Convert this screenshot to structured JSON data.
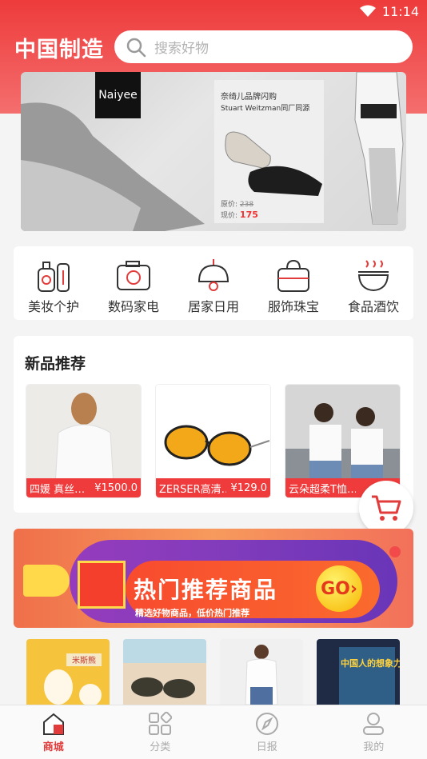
{
  "status": {
    "time": "11:14"
  },
  "header": {
    "brand": "中国制造",
    "search_placeholder": "搜索好物"
  },
  "banner": {
    "logo": "Naiyee",
    "card_line1": "奈绮儿品牌闪购",
    "card_line2": "Stuart Weitzman同厂同源",
    "orig_label": "原价:",
    "orig_price": "238",
    "now_label": "现价:",
    "now_price": "175"
  },
  "categories": [
    {
      "label": "美妆个护",
      "icon": "cosmetics-icon"
    },
    {
      "label": "数码家电",
      "icon": "camera-icon"
    },
    {
      "label": "居家日用",
      "icon": "lamp-icon"
    },
    {
      "label": "服饰珠宝",
      "icon": "bag-icon"
    },
    {
      "label": "食品酒饮",
      "icon": "bowl-icon"
    }
  ],
  "new_section": {
    "title": "新品推荐",
    "products": [
      {
        "name": "四媛 真丝…",
        "price": "¥1500.0"
      },
      {
        "name": "ZERSER高清…",
        "price": "¥129.0"
      },
      {
        "name": "云朵超柔T恤…",
        "price": "¥"
      }
    ]
  },
  "promo": {
    "title": "热门推荐商品",
    "subtitle": "精选好物商品，低价热门推荐",
    "go": "GO›"
  },
  "thumb_texts": {
    "t1": "米斯熊",
    "t4": "中国人的想象力"
  },
  "tabs": [
    {
      "label": "商城",
      "icon": "home-icon"
    },
    {
      "label": "分类",
      "icon": "category-icon"
    },
    {
      "label": "日报",
      "icon": "compass-icon"
    },
    {
      "label": "我的",
      "icon": "profile-icon"
    }
  ],
  "colors": {
    "accent": "#e23b3b",
    "header": "#ee3b3b"
  }
}
